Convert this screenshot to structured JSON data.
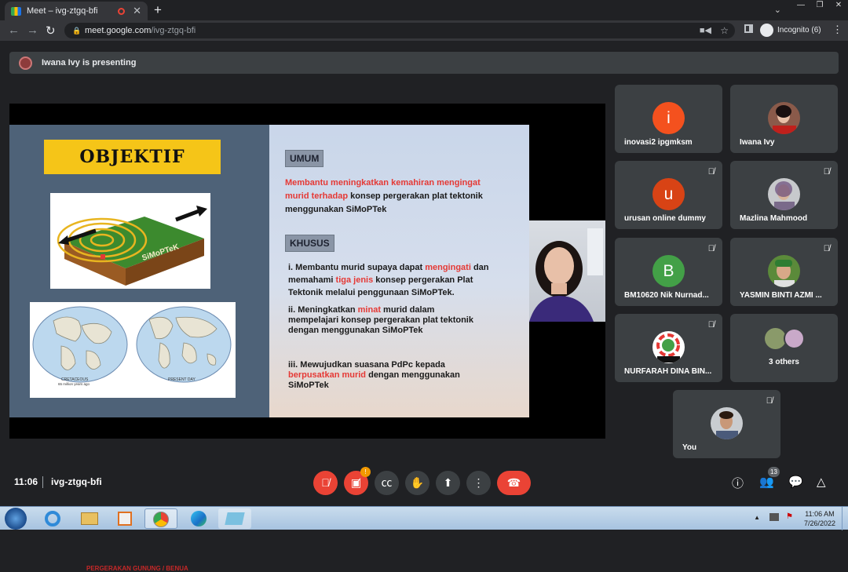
{
  "browser": {
    "tab_title": "Meet – ivg-ztgq-bfi",
    "new_tab": "+",
    "url_host": "meet.google.com",
    "url_path": "/ivg-ztgq-bfi",
    "profile_label": "Incognito (6)"
  },
  "banner": {
    "text": "Iwana Ivy is presenting"
  },
  "slide": {
    "title": "OBJEKTIF",
    "block_label": "SiMoPTeK",
    "map_caption": "PERGERAKAN GUNUNG / BENUA",
    "map_left_label": "CRETACEOUS",
    "map_left_sub": "65 million years ago",
    "map_right_label": "PRESENT DAY",
    "umum_header": "UMUM",
    "umum_red": "Membantu meningkatkan kemahiran mengingat murid terhadap",
    "umum_rest": "konsep pergerakan plat tektonik menggunakan SiMoPTek",
    "khusus_header": "KHUSUS",
    "p1_a": "i. Membantu murid supaya  dapat",
    "p1_r1": "mengingati",
    "p1_b": "dan memahami ",
    "p1_r2": "tiga jenis",
    "p1_c": "konsep pergerakan Plat Tektonik melalui penggunaan SiMoPTek.",
    "p2_a": "ii. Meningkatkan",
    "p2_r": "minat",
    "p2_b": "murid dalam mempelajari konsep pergerakan plat tektonik dengan menggunakan SiMoPTek",
    "p3_a": "iii. Mewujudkan suasana PdPc kepada",
    "p3_r": "berpusatkan murid",
    "p3_b": "dengan menggunakan SiMoPTek"
  },
  "participants": [
    {
      "name": "inovasi2 ipgmksm",
      "letter": "i",
      "color": "#f4511e",
      "muted": false
    },
    {
      "name": "Iwana Ivy",
      "photo": true,
      "muted": false
    },
    {
      "name": "urusan online dummy",
      "letter": "u",
      "color": "#d84315",
      "muted": true
    },
    {
      "name": "Mazlina Mahmood",
      "photo": true,
      "muted": true
    },
    {
      "name": "BM10620 Nik Nurnad...",
      "letter": "B",
      "color": "#43a047",
      "muted": true
    },
    {
      "name": "YASMIN BINTI AZMI ...",
      "photo": true,
      "muted": true
    },
    {
      "name": "NURFARAH DINA BIN...",
      "photo": true,
      "muted": true
    },
    {
      "name": "3 others",
      "muted": false
    },
    {
      "name": "You",
      "photo": true,
      "muted": true
    }
  ],
  "bottom": {
    "time": "11:06",
    "meeting_code": "ivg-ztgq-bfi",
    "camera_badge": "!",
    "people_count": "13"
  },
  "taskbar": {
    "time": "11:06 AM",
    "date": "7/26/2022"
  }
}
